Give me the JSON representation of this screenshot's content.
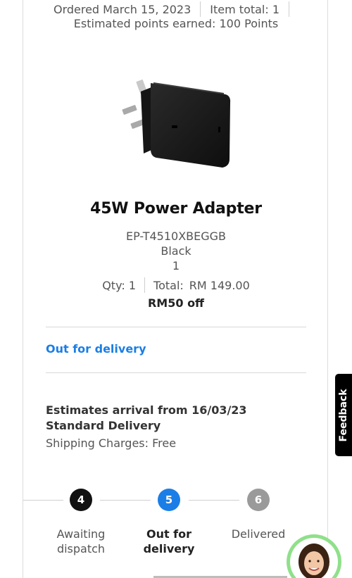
{
  "order": {
    "ordered_label": "Ordered March 15, 2023",
    "item_total": "Item total: 1",
    "points": "Estimated points earned: 100 Points"
  },
  "product": {
    "title": "45W Power Adapter",
    "model": "EP-T4510XBEGGB",
    "color": "Black",
    "quantity_value": "1",
    "qty_label": "Qty: 1",
    "total_label": "Total:",
    "total_value": "RM 149.00",
    "discount": "RM50 off",
    "image_icon": "power-adapter-image"
  },
  "delivery": {
    "status": "Out for delivery",
    "estimate": "Estimates arrival from 16/03/23 Standard Delivery",
    "shipping": "Shipping Charges: Free"
  },
  "tracker": {
    "steps": [
      {
        "number": "4",
        "label": "Awaiting dispatch",
        "state": "complete"
      },
      {
        "number": "5",
        "label": "Out for delivery",
        "state": "current"
      },
      {
        "number": "6",
        "label": "Delivered",
        "state": "pending"
      }
    ]
  },
  "widgets": {
    "feedback_label": "Feedback",
    "chat_icon": "chat-assistant-avatar-icon"
  },
  "colors": {
    "link_blue": "#1a7ee6",
    "step_complete": "#111111",
    "step_current": "#1a7ee6",
    "step_pending": "#9a9a9a",
    "avatar_ring": "#8fe08a"
  }
}
